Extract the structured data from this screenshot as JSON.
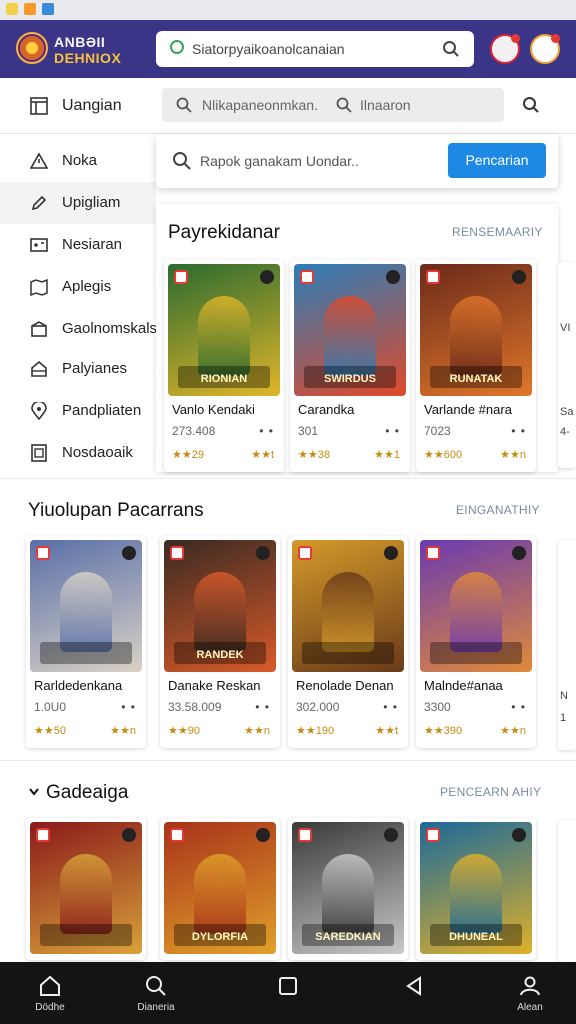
{
  "app": {
    "logo_line1": "ANBƏII",
    "logo_line2": "DEHNIOX",
    "top_search": "Siatorpyaikoanolcanaian",
    "accent": "#3a3586",
    "button_color": "#1e88e5"
  },
  "sidebar": {
    "header": {
      "label": "Uangian",
      "icon": "layout-icon"
    },
    "items": [
      {
        "label": "Noka",
        "icon": "warning-icon"
      },
      {
        "label": "Upigliam",
        "icon": "pencil-icon"
      },
      {
        "label": "Nesiaran",
        "icon": "game-icon"
      },
      {
        "label": "Aplegis",
        "icon": "map-icon"
      },
      {
        "label": "Gaolnomskals",
        "icon": "box-icon"
      },
      {
        "label": "Palyianes",
        "icon": "home-icon"
      },
      {
        "label": "Pandpliaten",
        "icon": "location-icon"
      },
      {
        "label": "Nosdaoaik",
        "icon": "tablet-icon"
      }
    ]
  },
  "search": {
    "text1": "Nlikapaneonmkan.",
    "text2": "Ilnaaron",
    "overlay_placeholder": "Rapok ganakam Uondar..",
    "overlay_button": "Pencarian"
  },
  "sections": [
    {
      "title": "Payrekidanar",
      "link": "RENSEMAARIY",
      "games": [
        {
          "name": "Vanlo Kendaki",
          "count": "273.408",
          "rating": "★★29",
          "rating2": "★★t",
          "art_text": "RIONIAN",
          "colors": [
            "#2b6b2f",
            "#e0b52a"
          ]
        },
        {
          "name": "Carandka",
          "count": "301",
          "rating": "★★38",
          "rating2": "★★1",
          "art_text": "SWIRDUS",
          "colors": [
            "#2a7db8",
            "#e04a2a"
          ]
        },
        {
          "name": "Varlande #nara",
          "count": "7023",
          "rating": "★★600",
          "rating2": "★★n",
          "art_text": "RUNATAK",
          "colors": [
            "#6b2a1a",
            "#e0762a"
          ]
        }
      ]
    },
    {
      "title": "Yiuolupan Pacarrans",
      "link": "EINGANATHIY",
      "games": [
        {
          "name": "Rarldedenkana",
          "count": "1.0U0",
          "rating": "★★50",
          "rating2": "★★n",
          "art_text": "",
          "colors": [
            "#5a6fa8",
            "#d9d2c6"
          ]
        },
        {
          "name": "Danake Reskan",
          "count": "33.58.009",
          "rating": "★★90",
          "rating2": "★★n",
          "art_text": "RANDEK",
          "colors": [
            "#3a2a22",
            "#d85a2a"
          ]
        },
        {
          "name": "Renolade Denan",
          "count": "302.000",
          "rating": "★★190",
          "rating2": "★★t",
          "art_text": "",
          "colors": [
            "#d49a2a",
            "#6a3a1a"
          ]
        },
        {
          "name": "Malnde#anaa",
          "count": "3300",
          "rating": "★★390",
          "rating2": "★★n",
          "art_text": "",
          "colors": [
            "#6a3ab0",
            "#e08a3a"
          ]
        }
      ]
    },
    {
      "title": "Gadeaiga",
      "link": "PENCEARN AHIY",
      "games": [
        {
          "name": "",
          "count": "",
          "rating": "",
          "rating2": "",
          "art_text": "",
          "colors": [
            "#8a1a1a",
            "#d8a23a"
          ]
        },
        {
          "name": "",
          "count": "",
          "rating": "",
          "rating2": "",
          "art_text": "DYLORFIA",
          "colors": [
            "#a8321a",
            "#e0a02a"
          ]
        },
        {
          "name": "",
          "count": "",
          "rating": "",
          "rating2": "",
          "art_text": "SAREDKIAN",
          "colors": [
            "#3a3a3a",
            "#c8c8c8"
          ]
        },
        {
          "name": "",
          "count": "",
          "rating": "",
          "rating2": "",
          "art_text": "DHUNEAL",
          "colors": [
            "#1a6a9a",
            "#e0b02a"
          ]
        }
      ]
    }
  ],
  "navbar": [
    {
      "label": "Dödhe",
      "icon": "home-icon"
    },
    {
      "label": "Dianeria",
      "icon": "search-icon"
    },
    {
      "label": "",
      "icon": "square-icon"
    },
    {
      "label": "",
      "icon": "back-icon"
    },
    {
      "label": "Alean",
      "icon": "user-icon"
    }
  ]
}
